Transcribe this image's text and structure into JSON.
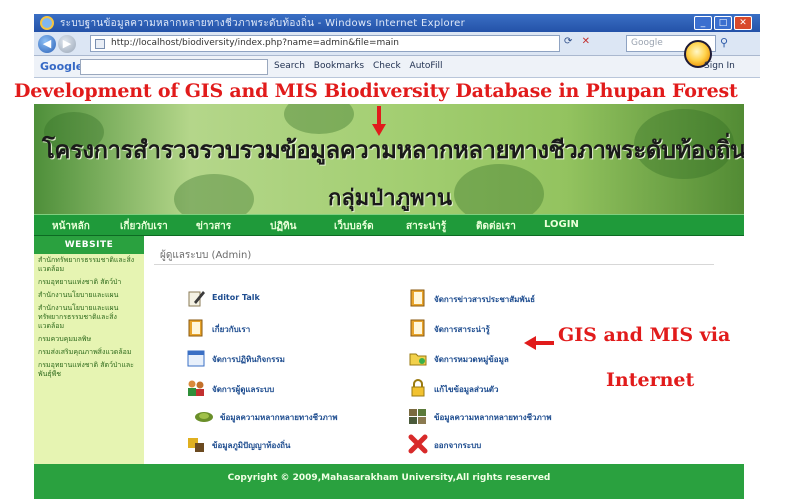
{
  "browser": {
    "window_title": "ระบบฐานข้อมูลความหลากหลายทางชีวภาพระดับท้องถิ่น - Windows Internet Explorer",
    "address": "http://localhost/biodiversity/index.php?name=admin&file=main",
    "search_placeholder": "Google",
    "toolbar": {
      "google_label": "Google",
      "search_label": "Search",
      "bookmarks_label": "Bookmarks",
      "check_label": "Check",
      "autofill_label": "AutoFill",
      "signin_label": "Sign In"
    }
  },
  "annotations": {
    "title": "Development of GIS and MIS Biodiversity Database in Phupan Forest",
    "note_line1": "GIS and MIS via",
    "note_line2": "Internet",
    "color": "#e11b1b"
  },
  "site": {
    "banner_title": "โครงการสำรวจรวบรวมข้อมูลความหลากหลายทางชีวภาพระดับท้องถิ่น",
    "banner_subtitle": "กลุ่มป่าภูพาน",
    "menu": [
      "หน้าหลัก",
      "เกี่ยวกับเรา",
      "ข่าวสาร",
      "ปฏิทิน",
      "เว็บบอร์ด",
      "สาระน่ารู้",
      "ติดต่อเรา",
      "LOGIN"
    ],
    "sidebar_header": "WEBSITE",
    "sidebar_links": [
      "สำนักทรัพยากรธรรมชาติและสิ่งแวดล้อม",
      "กรมอุทยานแห่งชาติ สัตว์ป่า",
      "สำนักงานนโยบายและแผน",
      "สำนักงานนโยบายและแผนทรัพยากรธรรมชาติและสิ่งแวดล้อม",
      "กรมควบคุมมลพิษ",
      "กรมส่งเสริมคุณภาพสิ่งแวดล้อม",
      "กรมอุทยานแห่งชาติ สัตว์ป่าและพันธุ์พืช"
    ],
    "breadcrumb": "ผู้ดูแลระบบ (Admin)",
    "admin_items_left": [
      {
        "label": "Editor Talk",
        "icon": "pen-icon"
      },
      {
        "label": "เกี่ยวกับเรา",
        "icon": "book-icon"
      },
      {
        "label": "จัดการปฏิทินกิจกรรม",
        "icon": "calendar-icon"
      },
      {
        "label": "จัดการผู้ดูแลระบบ",
        "icon": "users-icon"
      },
      {
        "label": "ข้อมูลความหลากหลายทางชีวภาพ",
        "icon": "plant-icon"
      },
      {
        "label": "ข้อมูลภูมิปัญญาท้องถิ่น",
        "icon": "puzzle-icon"
      }
    ],
    "admin_items_right": [
      {
        "label": "จัดการข่าวสารประชาสัมพันธ์",
        "icon": "book-icon"
      },
      {
        "label": "จัดการสาระน่ารู้",
        "icon": "book-icon"
      },
      {
        "label": "จัดการหมวดหมู่ข้อมูล",
        "icon": "folder-icon"
      },
      {
        "label": "แก้ไขข้อมูลส่วนตัว",
        "icon": "lock-icon"
      },
      {
        "label": "ข้อมูลความหลากหลายทางชีวภาพ",
        "icon": "gallery-icon"
      },
      {
        "label": "ออกจากระบบ",
        "icon": "logout-icon"
      }
    ],
    "footer": "Copyright © 2009,Mahasarakham University,All rights reserved"
  }
}
